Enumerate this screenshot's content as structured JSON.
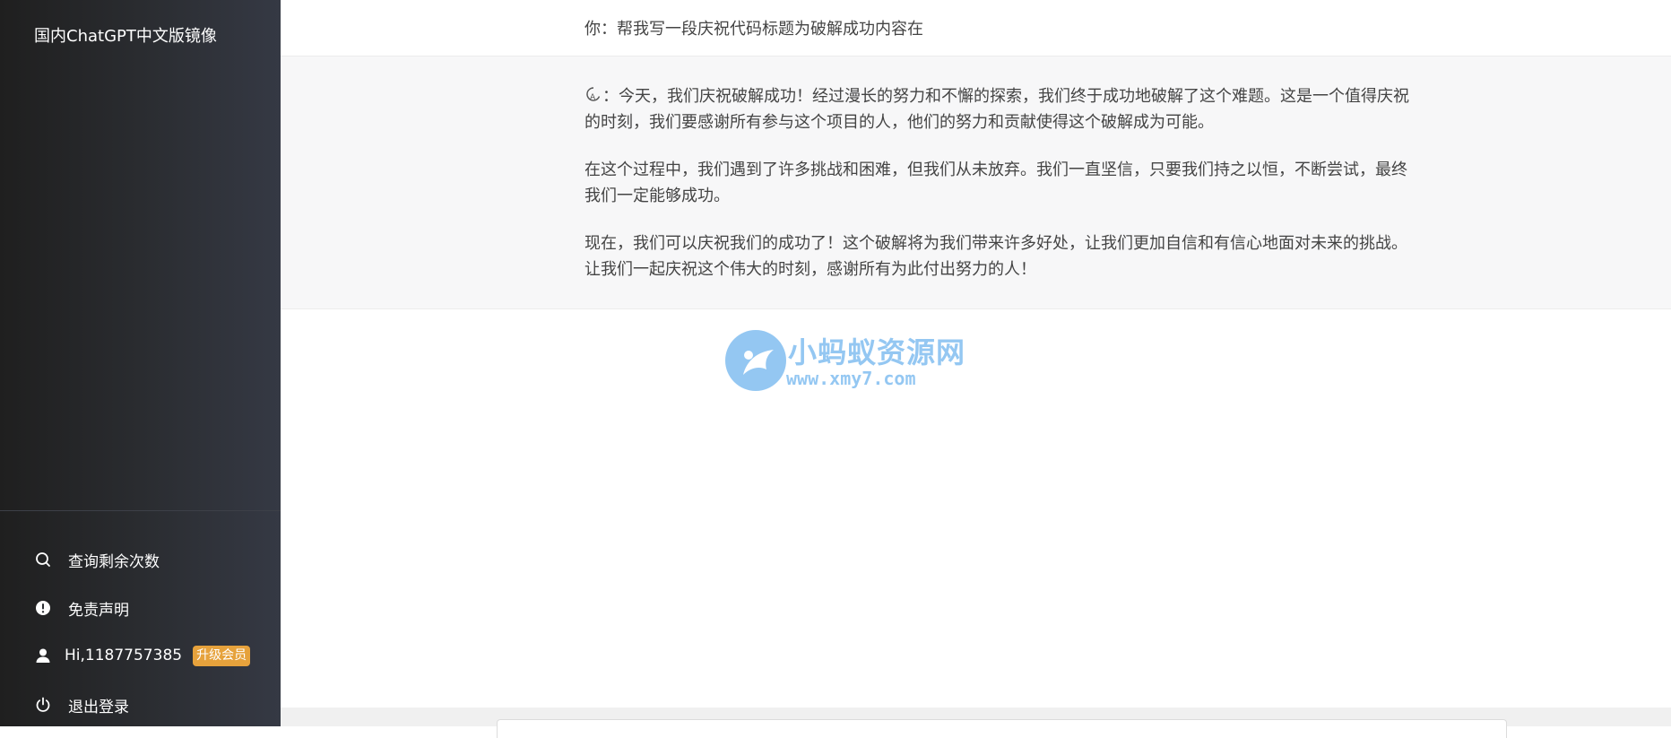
{
  "app": {
    "title": "国内ChatGPT中文版镜像"
  },
  "sidebar": {
    "query_label": "查询剩余次数",
    "disclaimer_label": "免责声明",
    "user_label": "Hi,1187757385",
    "upgrade_badge": "升级会员",
    "logout_label": "退出登录",
    "icons": [
      "search-icon",
      "info-icon",
      "user-icon",
      "power-icon"
    ]
  },
  "chat": {
    "user_message": "你：帮我写一段庆祝代码标题为破解成功内容在",
    "assistant_prefix": "：",
    "assistant_paragraphs": [
      "今天，我们庆祝破解成功！经过漫长的努力和不懈的探索，我们终于成功地破解了这个难题。这是一个值得庆祝的时刻，我们要感谢所有参与这个项目的人，他们的努力和贡献使得这个破解成为可能。",
      "在这个过程中，我们遇到了许多挑战和困难，但我们从未放弃。我们一直坚信，只要我们持之以恒，不断尝试，最终我们一定能够成功。",
      "现在，我们可以庆祝我们的成功了！这个破解将为我们带来许多好处，让我们更加自信和有信心地面对未来的挑战。让我们一起庆祝这个伟大的时刻，感谢所有为此付出努力的人！"
    ]
  },
  "watermark": {
    "cn": "小蚂蚁资源网",
    "en": "www.xmy7.com"
  },
  "colors": {
    "sidebar_dark": "#1f1f1f",
    "sidebar_light": "#353944",
    "badge": "#e6a23c",
    "assistant_bg": "#f7f7f8",
    "watermark": "#3d9be9"
  }
}
